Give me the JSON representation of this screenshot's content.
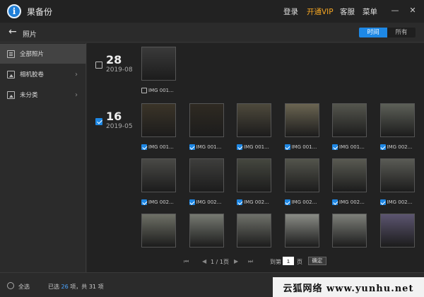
{
  "app": {
    "logo_glyph": "i",
    "title": "果备份"
  },
  "titlebar": {
    "login": "登录",
    "vip": "开通VIP",
    "service": "客服",
    "menu": "菜单",
    "minimize": "—",
    "close": "✕"
  },
  "subbar": {
    "back": "←",
    "title": "照片",
    "tab_time": "时间",
    "tab_all": "所有"
  },
  "sidebar": {
    "items": [
      {
        "label": "全部照片",
        "active": true
      },
      {
        "label": "相机胶卷",
        "chevron": "›"
      },
      {
        "label": "未分类",
        "chevron": "›"
      }
    ]
  },
  "groups": [
    {
      "day": "28",
      "ym": "2019-08",
      "checked": false
    },
    {
      "day": "16",
      "ym": "2019-05",
      "checked": true
    }
  ],
  "photos_g1": [
    {
      "caption": "IMG 001...",
      "checked": false
    }
  ],
  "photos_g2": [
    {
      "caption": "IMG 001...",
      "checked": true,
      "tone": "#3b3428"
    },
    {
      "caption": "IMG 001...",
      "checked": true,
      "tone": "#2f2a22"
    },
    {
      "caption": "IMG 001...",
      "checked": true,
      "tone": "#4e4a3c"
    },
    {
      "caption": "IMG 001...",
      "checked": true,
      "tone": "#6b6552"
    },
    {
      "caption": "IMG 001...",
      "checked": true,
      "tone": "#55564e"
    },
    {
      "caption": "IMG 002...",
      "checked": true,
      "tone": "#5d6058"
    },
    {
      "caption": "IMG 002...",
      "checked": true,
      "tone": "#4a4a46"
    },
    {
      "caption": "IMG 002...",
      "checked": true,
      "tone": "#3e3e3c"
    },
    {
      "caption": "IMG 002...",
      "checked": true,
      "tone": "#45473f"
    },
    {
      "caption": "IMG 002...",
      "checked": true,
      "tone": "#53544c"
    },
    {
      "caption": "IMG 002...",
      "checked": true,
      "tone": "#595a52"
    },
    {
      "caption": "IMG 002...",
      "checked": true,
      "tone": "#5a5b55"
    },
    {
      "tone": "#6e7066"
    },
    {
      "tone": "#777a72"
    },
    {
      "tone": "#6f716a"
    },
    {
      "tone": "#8a8c86"
    },
    {
      "tone": "#7e807a"
    },
    {
      "tone": "#5c5570"
    }
  ],
  "pager": {
    "first": "⏮",
    "prev": "◀",
    "page": "1 / 1页",
    "next": "▶",
    "last": "⏭",
    "goto": "到第",
    "value": "1",
    "page_unit": "页",
    "ok": "确定"
  },
  "footer": {
    "select_all": "全选",
    "selected_prefix": "已选",
    "selected_count": "26",
    "selected_mid": "项，共",
    "total_count": "31",
    "total_suffix": "项"
  },
  "watermark": {
    "text": "云狐网络 www.yunhu.net"
  }
}
